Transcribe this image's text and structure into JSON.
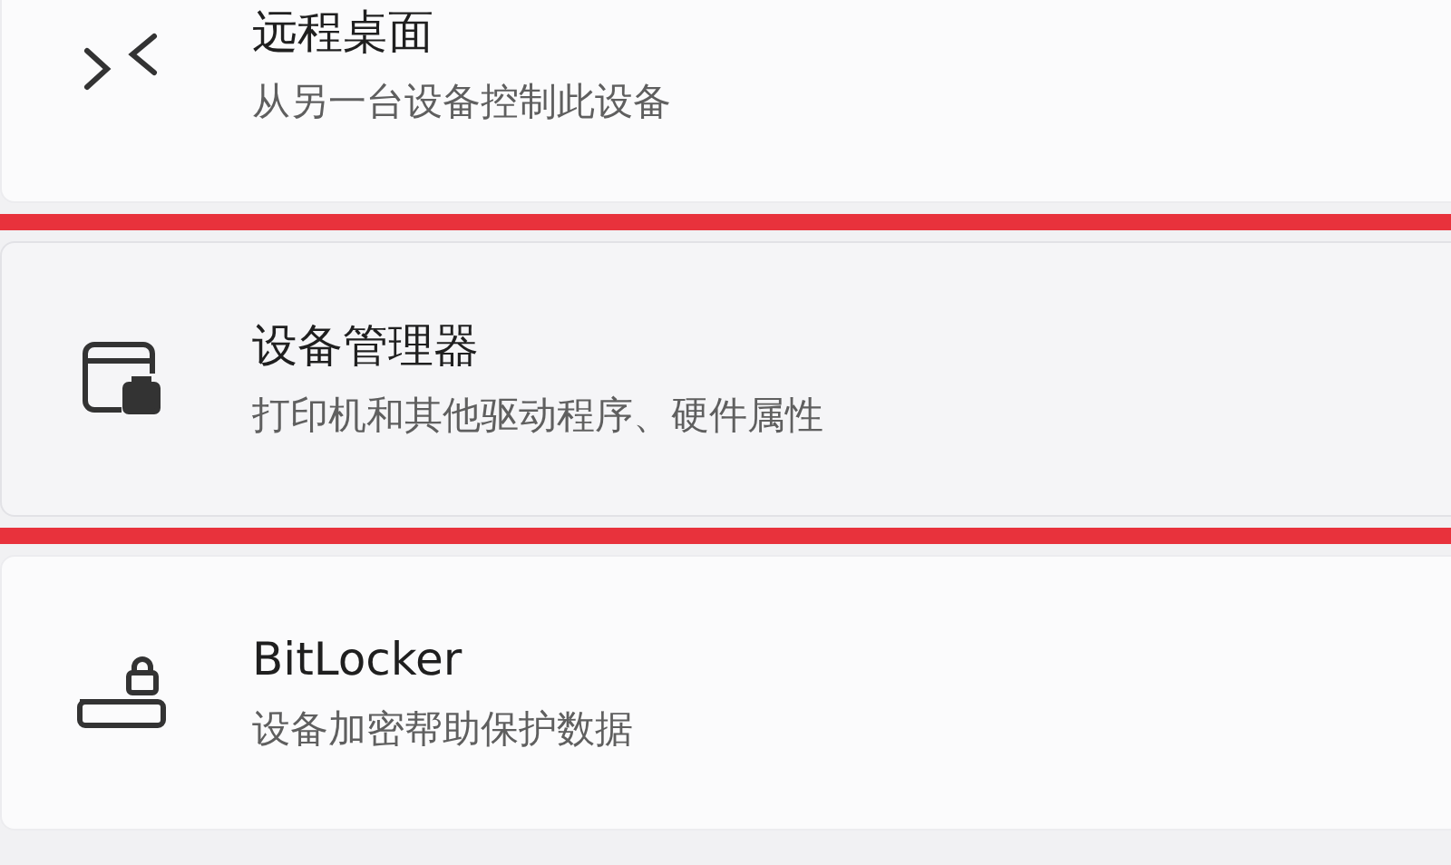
{
  "settings_items": [
    {
      "kind": "remote",
      "title": "远程桌面",
      "description": "从另一台设备控制此设备",
      "highlighted": false
    },
    {
      "kind": "manager",
      "title": "设备管理器",
      "description": "打印机和其他驱动程序、硬件属性",
      "highlighted": true
    },
    {
      "kind": "encryption",
      "title": "BitLocker",
      "description": "设备加密帮助保护数据",
      "highlighted": false
    }
  ]
}
